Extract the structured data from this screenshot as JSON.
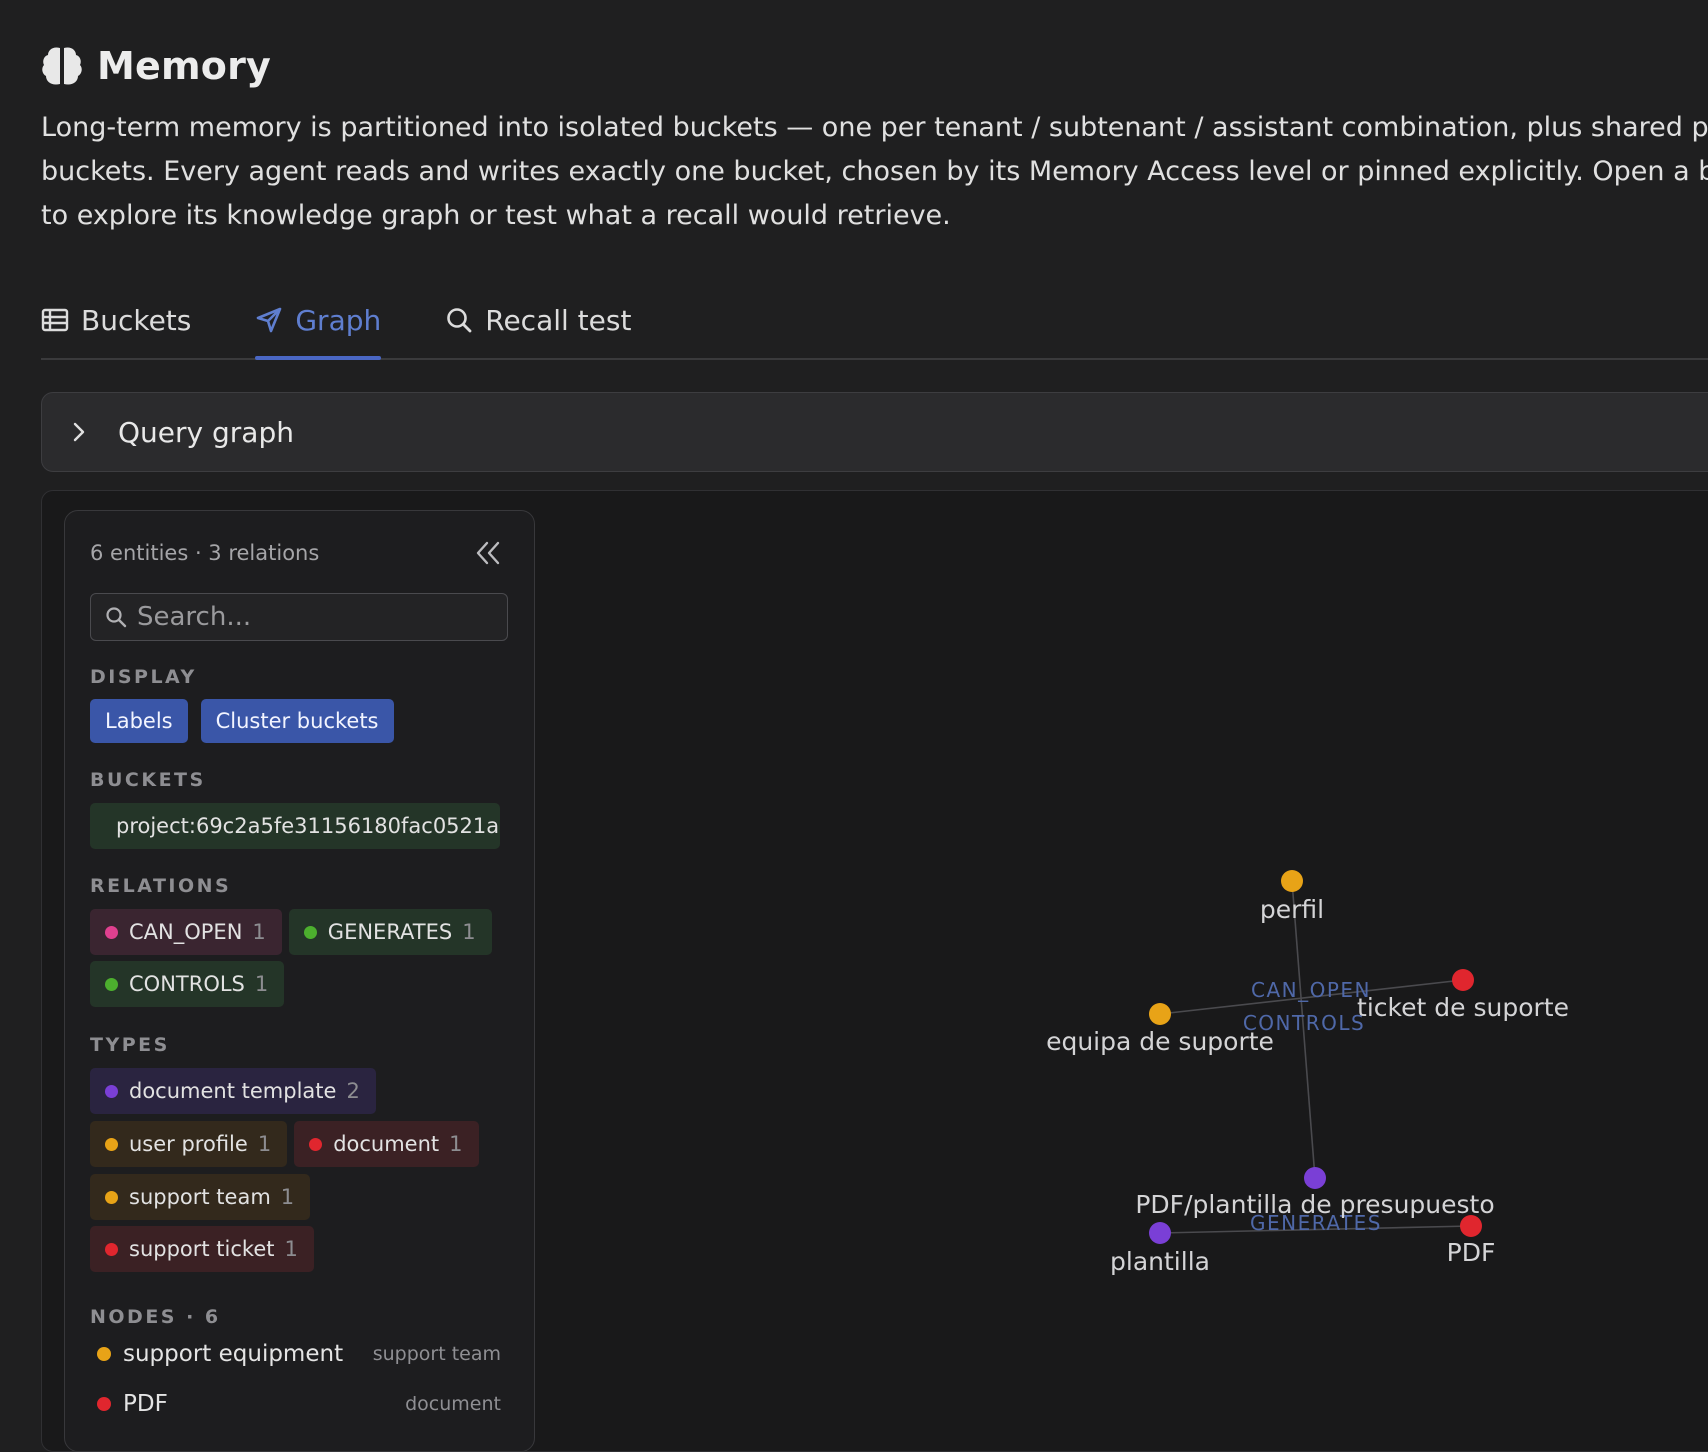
{
  "header": {
    "title": "Memory",
    "icon": "brain-icon"
  },
  "description": "Long-term memory is partitioned into isolated buckets — one per tenant / subtenant / assistant combination, plus shared project buckets. Every agent reads and writes exactly one bucket, chosen by its Memory Access level or pinned explicitly. Open a bucket to explore its knowledge graph or test what a recall would retrieve.",
  "tabs": [
    {
      "label": "Buckets",
      "icon": "table-icon",
      "active": false
    },
    {
      "label": "Graph",
      "icon": "send-icon",
      "active": true
    },
    {
      "label": "Recall test",
      "icon": "search-icon",
      "active": false
    }
  ],
  "query": {
    "label": "Query graph"
  },
  "panel": {
    "summary": "6 entities · 3 relations",
    "search_placeholder": "Search...",
    "display_title": "DISPLAY",
    "display_buttons": [
      "Labels",
      "Cluster buckets"
    ],
    "buckets_title": "BUCKETS",
    "bucket": {
      "label": "project:69c2a5fe31156180fac0521a ›",
      "color": "#4caf2e"
    },
    "relations_title": "RELATIONS",
    "relations": [
      {
        "name": "CAN_OPEN",
        "count": "1",
        "color": "#e0408f"
      },
      {
        "name": "GENERATES",
        "count": "1",
        "color": "#4caf2e"
      },
      {
        "name": "CONTROLS",
        "count": "1",
        "color": "#4caf2e"
      }
    ],
    "types_title": "TYPES",
    "types": [
      {
        "name": "document template",
        "count": "2",
        "color": "#7a3fd6"
      },
      {
        "name": "user profile",
        "count": "1",
        "color": "#e8a317"
      },
      {
        "name": "document",
        "count": "1",
        "color": "#e0262e"
      },
      {
        "name": "support team",
        "count": "1",
        "color": "#e8a317"
      },
      {
        "name": "support ticket",
        "count": "1",
        "color": "#e0262e"
      }
    ],
    "nodes_title": "NODES · 6",
    "nodes": [
      {
        "name": "support equipment",
        "type": "support team",
        "color": "#e8a317"
      },
      {
        "name": "PDF",
        "type": "document",
        "color": "#e0262e"
      }
    ]
  },
  "graph": {
    "nodes": [
      {
        "label": "perfil",
        "color": "#e8a317"
      },
      {
        "label": "equipa de suporte",
        "color": "#e8a317"
      },
      {
        "label": "ticket de suporte",
        "color": "#e0262e"
      },
      {
        "label": "PDF/plantilla de presupuesto",
        "color": "#7a3fd6"
      },
      {
        "label": "plantilla",
        "color": "#7a3fd6"
      },
      {
        "label": "PDF",
        "color": "#e0262e"
      }
    ],
    "edges": [
      "CAN_OPEN",
      "CONTROLS",
      "GENERATES"
    ],
    "edge_label_color": "#4f68a8"
  }
}
